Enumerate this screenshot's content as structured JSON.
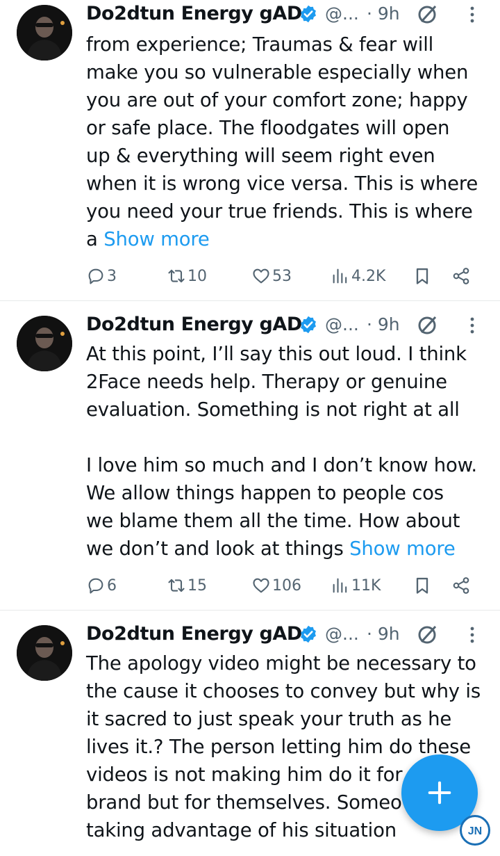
{
  "tweets": [
    {
      "author": "Do2dtun Energy gAD",
      "handle": "@...",
      "time": "· 9h",
      "lines": [
        "from experience; Traumas & fear will",
        "make you so vulnerable especially when",
        "you are out of your comfort zone; happy",
        "or safe place. The floodgates will open",
        "up & everything will seem right even",
        "when it is wrong vice versa. This is where",
        "you need your true friends. This is where"
      ],
      "last_line_prefix": "a ",
      "show_more": "Show more",
      "stats": {
        "replies": "3",
        "reposts": "10",
        "likes": "53",
        "views": "4.2K"
      }
    },
    {
      "author": "Do2dtun Energy gAD",
      "handle": "@...",
      "time": "· 9h",
      "lines": [
        "At this point, I’ll say this out loud. I think",
        "2Face needs help. Therapy or genuine",
        "evaluation. Something is not right at all",
        "",
        "I love him so much and I don’t know how.",
        "We allow things happen to people cos",
        "we blame them all the time. How about"
      ],
      "last_line_prefix": "we don’t and look at things ",
      "show_more": "Show more",
      "stats": {
        "replies": "6",
        "reposts": "15",
        "likes": "106",
        "views": "11K"
      }
    },
    {
      "author": "Do2dtun Energy gAD",
      "handle": "@...",
      "time": "· 9h",
      "lines": [
        "The apology video might be necessary to",
        "the cause it chooses to convey but why is",
        "it sacred to just speak your truth as he",
        "lives it.? The person letting him do these",
        "videos is not making him do it for",
        "brand but for themselves. Someo",
        "taking advantage of his situation"
      ]
    }
  ],
  "fab": {
    "icon": "plus-icon"
  },
  "watermark": {
    "text": "JN"
  },
  "colors": {
    "accent": "#1d9bf0",
    "muted": "#536471",
    "text": "#0f1419",
    "divider": "#e7e9ea"
  }
}
